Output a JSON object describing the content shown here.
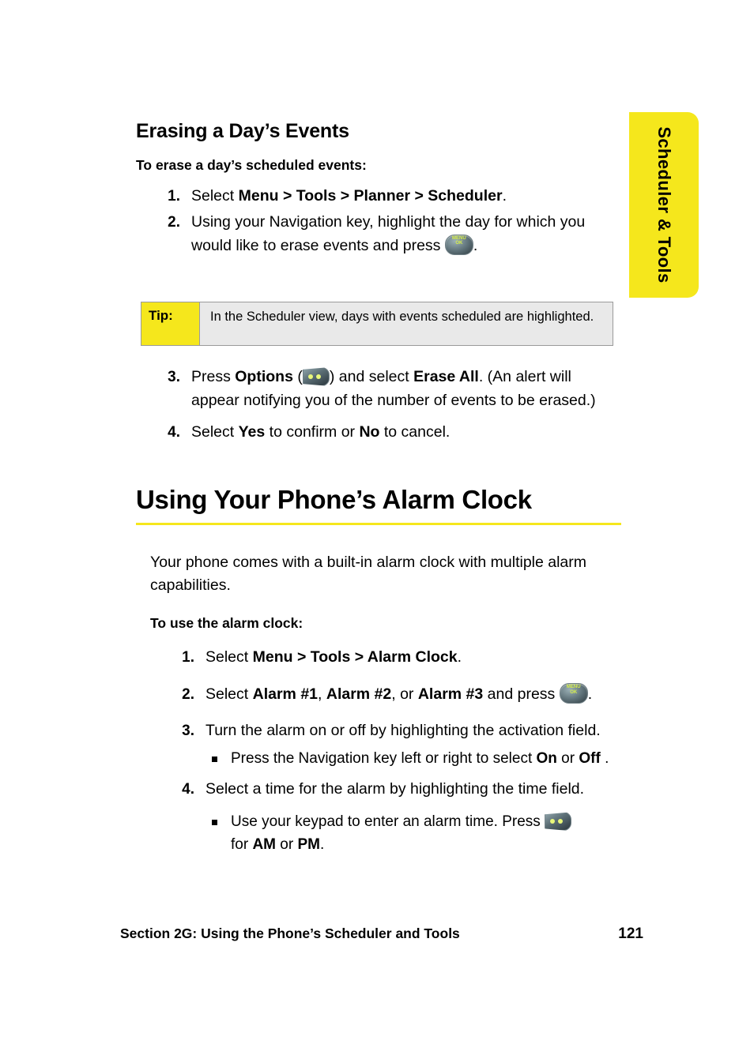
{
  "side_tab": {
    "label": "Scheduler & Tools",
    "color": "#f5e71c"
  },
  "section1": {
    "heading": "Erasing a Day’s Events",
    "lead": "To erase a day’s scheduled events:",
    "step1_prefix": "Select ",
    "step1_bold": "Menu > Tools > Planner > Scheduler",
    "step1_suffix": ".",
    "step2_text": "Using your Navigation key, highlight the day for which you would like to erase events and press",
    "step2_after": ".",
    "step3_prefix": "Press ",
    "step3_bold1": "Options",
    "step3_mid": " (",
    "step3_mid2": ") and select ",
    "step3_bold2": "Erase All",
    "step3_suffix": ". (An alert will appear notifying you of the number of events to be erased.)",
    "step4_prefix": "Select ",
    "step4_bold1": "Yes",
    "step4_mid": " to confirm or ",
    "step4_bold2": "No",
    "step4_suffix": " to cancel."
  },
  "tip": {
    "label": "Tip:",
    "text": "In the Scheduler view, days with events scheduled are highlighted."
  },
  "section2": {
    "heading": "Using Your Phone’s Alarm Clock",
    "intro": "Your phone comes with a built-in alarm clock with multiple alarm capabilities.",
    "lead": "To use the alarm clock:",
    "step1_prefix": "Select ",
    "step1_bold": "Menu > Tools > Alarm Clock",
    "step1_suffix": ".",
    "step2_prefix": "Select ",
    "step2_bold1": "Alarm #1",
    "step2_sep1": ", ",
    "step2_bold2": "Alarm #2",
    "step2_sep2": ", or ",
    "step2_bold3": "Alarm #3",
    "step2_suffix": " and press",
    "step2_end": ".",
    "step3_text": "Turn the alarm on or off by highlighting the activation field.",
    "step3_sub_prefix": "Press the Navigation key left or right to select ",
    "step3_sub_bold1": "On",
    "step3_sub_mid": " or ",
    "step3_sub_bold2": "Off",
    "step3_sub_suffix": " .",
    "step4_text": "Select a time for the alarm by highlighting the time field.",
    "step4_sub_prefix": "Use your keypad to enter an alarm time. Press",
    "step4_sub_mid": "for ",
    "step4_sub_bold1": "AM",
    "step4_sub_sep": " or ",
    "step4_sub_bold2": "PM",
    "step4_sub_suffix": "."
  },
  "numbers": {
    "n1": "1.",
    "n2": "2.",
    "n3": "3.",
    "n4": "4."
  },
  "footer": {
    "section_label": "Section 2G: Using the Phone’s Scheduler and Tools",
    "page": "121"
  },
  "icons": {
    "menu_ok": "menu-ok-key-icon",
    "soft_key": "options-soft-key-icon"
  }
}
